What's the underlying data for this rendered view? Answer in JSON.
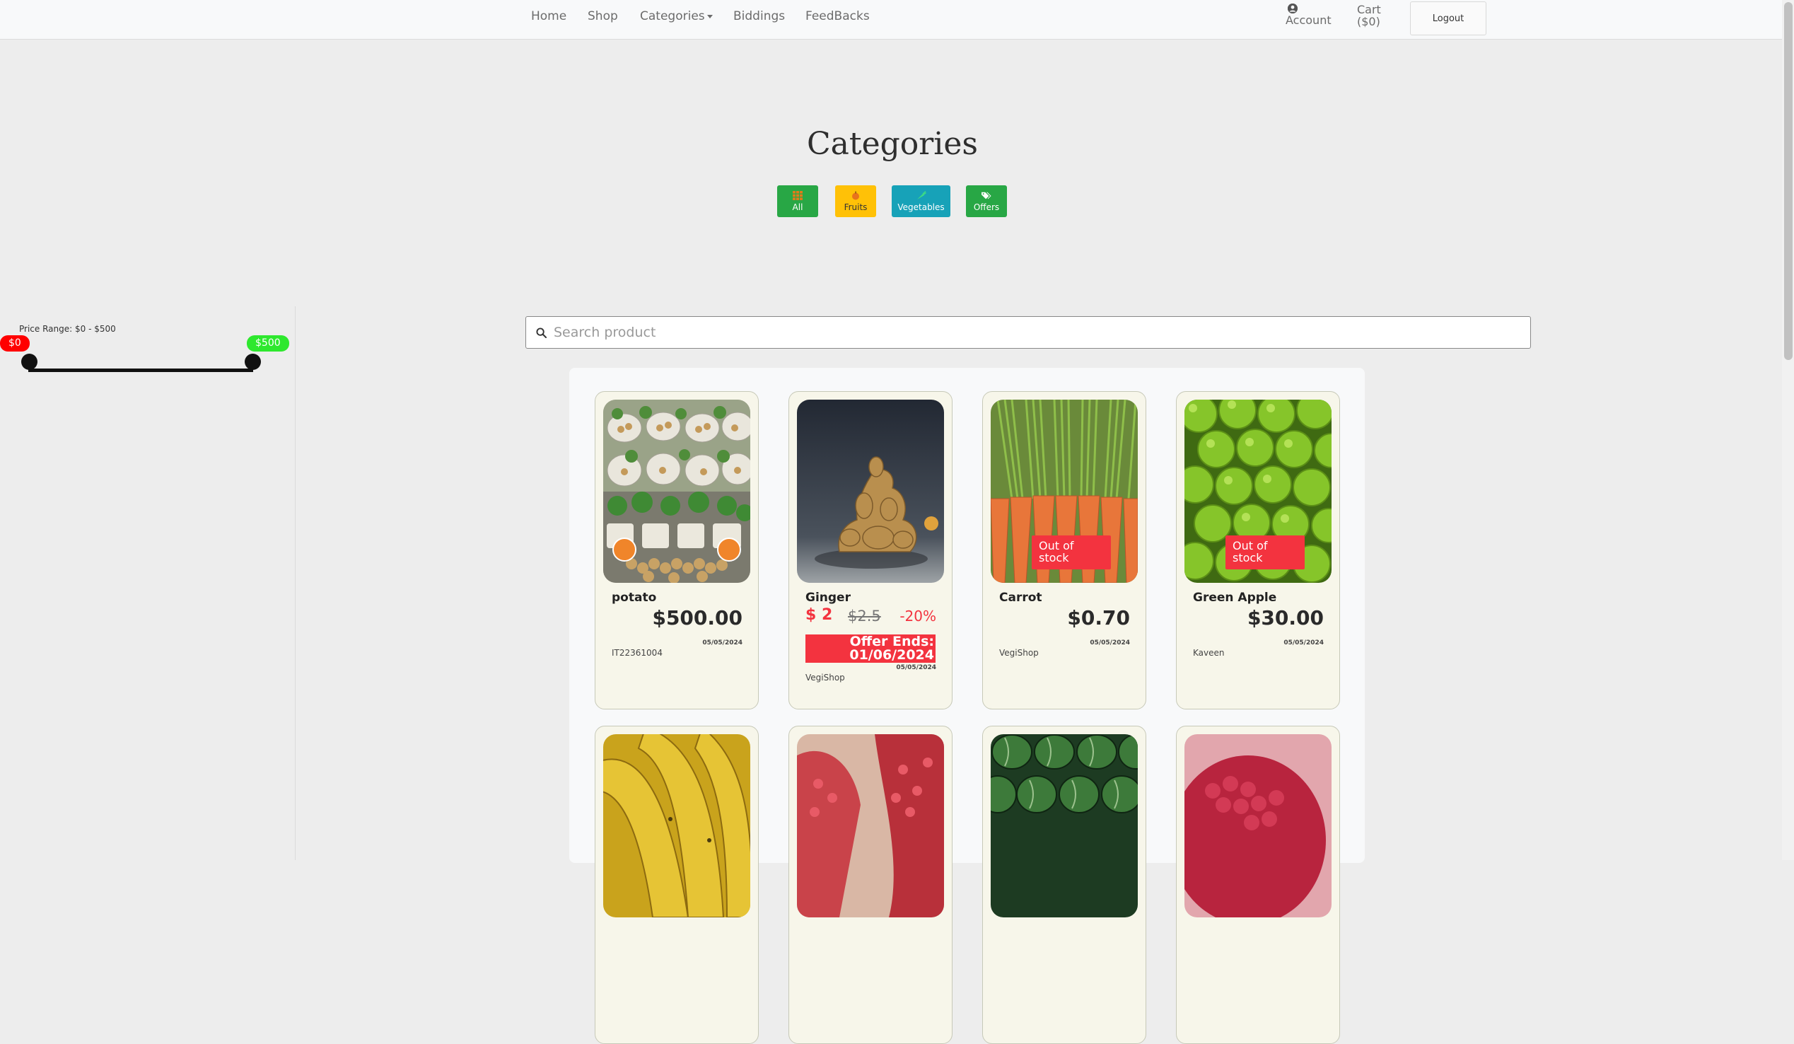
{
  "nav": {
    "links": [
      "Home",
      "Shop",
      "Categories",
      "Biddings",
      "FeedBacks"
    ],
    "account_label": "Account",
    "cart_label": "Cart",
    "cart_amount": "($0)",
    "logout_label": "Logout"
  },
  "categories": {
    "title": "Categories",
    "buttons": [
      {
        "label": "All",
        "color": "#28a745",
        "icon": "grid-icon"
      },
      {
        "label": "Fruits",
        "color": "#ffc107",
        "icon": "apple-icon"
      },
      {
        "label": "Vegetables",
        "color": "#17a2b8",
        "icon": "carrot-icon"
      },
      {
        "label": "Offers",
        "color": "#28a745",
        "icon": "tags-icon"
      }
    ]
  },
  "filter": {
    "price_range_label": "Price Range: $0 - $500",
    "min_badge": "$0",
    "max_badge": "$500",
    "min_value": 0,
    "max_value": 500
  },
  "search": {
    "placeholder": "Search product"
  },
  "products": [
    {
      "name": "potato",
      "price": "$500.00",
      "date": "05/05/2024",
      "seller": "IT22361004",
      "image": "potato-bags-image"
    },
    {
      "name": "Ginger",
      "offer_price": "$ 2",
      "old_price": "$2.5",
      "discount": "-20%",
      "offer_ends_label": "Offer Ends:",
      "offer_ends_date": "01/06/2024",
      "date": "05/05/2024",
      "seller": "VegiShop",
      "image": "ginger-image"
    },
    {
      "name": "Carrot",
      "price": "$0.70",
      "date": "05/05/2024",
      "seller": "VegiShop",
      "status": "Out of stock",
      "image": "carrots-image"
    },
    {
      "name": "Green Apple",
      "price": "$30.00",
      "date": "05/05/2024",
      "seller": "Kaveen",
      "status": "Out of stock",
      "image": "green-apples-image"
    },
    {
      "image": "bananas-image"
    },
    {
      "image": "pomegranate-image"
    },
    {
      "image": "watermelons-image"
    },
    {
      "image": "raspberry-image"
    }
  ],
  "colors": {
    "accent_red": "#f3333f",
    "min_badge": "#ff0000",
    "max_badge": "#2ee82e",
    "card_bg": "#f7f6ea"
  }
}
